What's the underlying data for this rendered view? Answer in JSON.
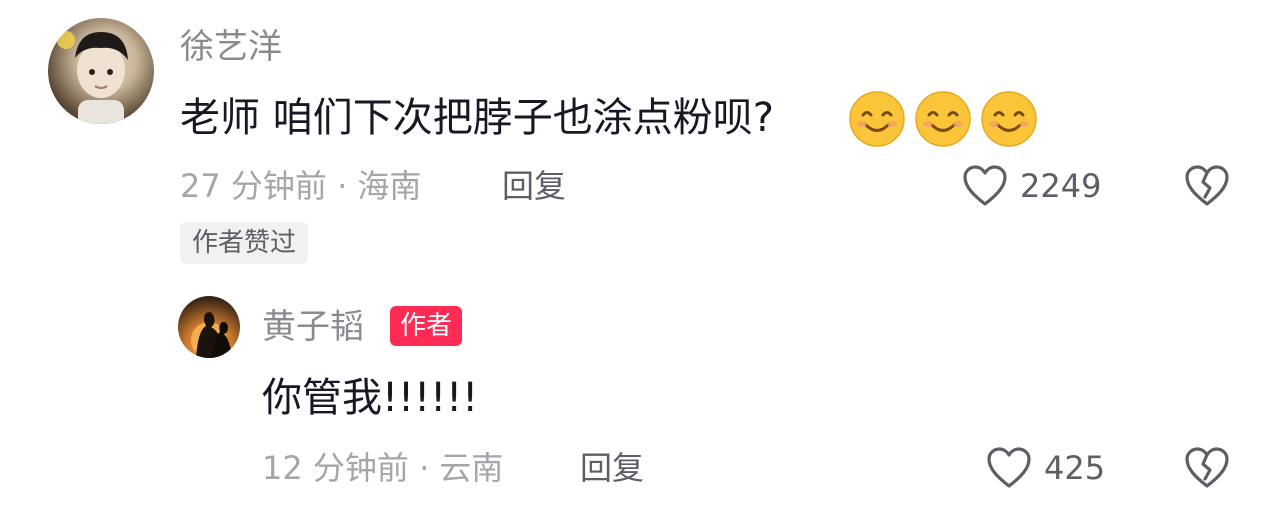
{
  "comments": [
    {
      "username": "徐艺洋",
      "text": "老师 咱们下次把脖子也涂点粉呗?",
      "emoji_count": 3,
      "emoji_icon": "smiling-face-icon",
      "time_location": "27 分钟前 · 海南",
      "reply_label": "回复",
      "like_count": "2249",
      "liked_tag": "作者赞过"
    },
    {
      "username": "黄子韬",
      "author_badge": "作者",
      "text": "你管我!!!!!!",
      "time_location": "12 分钟前 · 云南",
      "reply_label": "回复",
      "like_count": "425"
    }
  ],
  "icons": {
    "like": "heart-outline-icon",
    "dislike": "broken-heart-icon"
  },
  "colors": {
    "author_badge": "#fe2c55",
    "username": "#8a8b91",
    "meta": "#a5a6ab"
  }
}
